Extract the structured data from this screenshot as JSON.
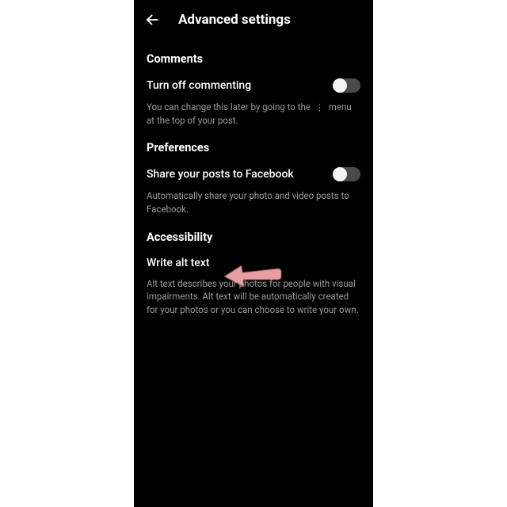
{
  "header": {
    "title": "Advanced settings"
  },
  "sections": {
    "comments": {
      "title": "Comments",
      "toggle_label": "Turn off commenting",
      "desc": "You can change this later by going to the  ⋮  menu at the top of your post."
    },
    "preferences": {
      "title": "Preferences",
      "toggle_label": "Share your posts to Facebook",
      "desc": "Automatically share your photo and video posts to Facebook."
    },
    "accessibility": {
      "title": "Accessibility",
      "item_label": "Write alt text",
      "desc": "Alt text describes your photos for people with visual impairments. Alt text will be automatically created for your photos or you can choose to write your own."
    }
  },
  "annotation_color": "#e99fa2"
}
